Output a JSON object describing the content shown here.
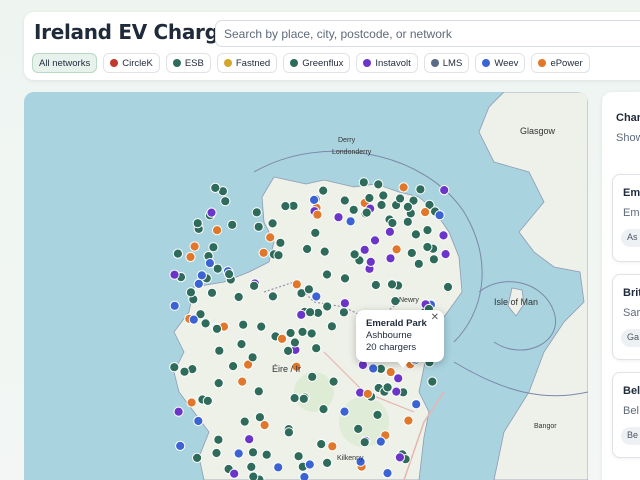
{
  "header": {
    "title": "Ireland EV Chargers",
    "search_placeholder": "Search by place, city, postcode, or network"
  },
  "filters": [
    {
      "label": "All networks",
      "color": "",
      "active": true
    },
    {
      "label": "CircleK",
      "color": "#c0392b",
      "active": false
    },
    {
      "label": "ESB",
      "color": "#2e6b5a",
      "active": false
    },
    {
      "label": "Fastned",
      "color": "#d4a72c",
      "active": false
    },
    {
      "label": "Greenflux",
      "color": "#2e6b5a",
      "active": false
    },
    {
      "label": "Instavolt",
      "color": "#6b35c9",
      "active": false
    },
    {
      "label": "LMS",
      "color": "#5b6b86",
      "active": false
    },
    {
      "label": "Weev",
      "color": "#3b63d4",
      "active": false
    },
    {
      "label": "ePower",
      "color": "#e0772a",
      "active": false
    }
  ],
  "map": {
    "labels": {
      "glasgow": "Glasgow",
      "derry": "Derry",
      "londonderry": "Londonderry",
      "newry": "Newry",
      "isle_of_man": "Isle of Man",
      "eire": "Éire / Ir",
      "bangor": "Bangor",
      "kilkenny": "Kilkenny"
    },
    "popup": {
      "name": "Emerald Park",
      "place": "Ashbourne",
      "chargers": "20 chargers"
    },
    "marker_colors": {
      "esb": "#2e6b5a",
      "epower": "#e0772a",
      "weev": "#3b63d4",
      "instavolt": "#6b35c9"
    }
  },
  "panel": {
    "title": "Char",
    "subtitle": "Show",
    "cards": [
      {
        "name": "Emer",
        "sub": "Em",
        "tag": "As"
      },
      {
        "name": "Brit",
        "sub": "Sar",
        "tag": "Ga"
      },
      {
        "name": "Bel",
        "sub": "Bel",
        "tag": "Be"
      }
    ]
  }
}
